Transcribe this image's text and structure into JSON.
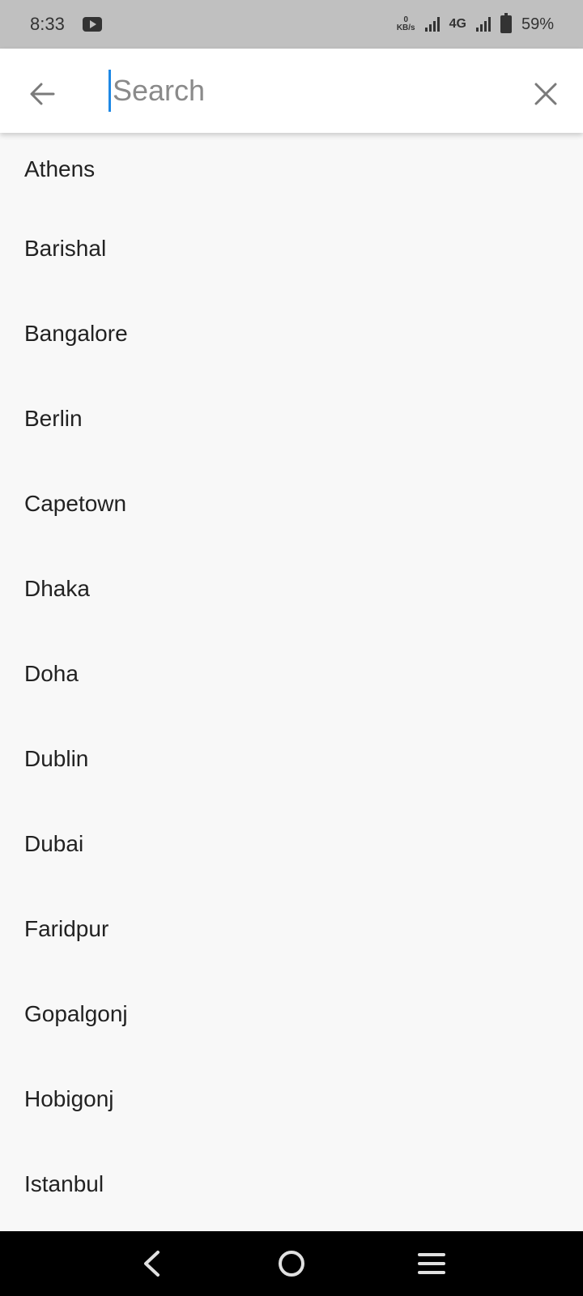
{
  "status_bar": {
    "time": "8:33",
    "net_speed_value": "0",
    "net_speed_unit": "KB/s",
    "network_type": "4G",
    "battery": "59%"
  },
  "search": {
    "placeholder": "Search",
    "value": ""
  },
  "cities": [
    {
      "name": "Athens"
    },
    {
      "name": "Barishal"
    },
    {
      "name": "Bangalore"
    },
    {
      "name": "Berlin"
    },
    {
      "name": "Capetown"
    },
    {
      "name": "Dhaka"
    },
    {
      "name": "Doha"
    },
    {
      "name": "Dublin"
    },
    {
      "name": "Dubai"
    },
    {
      "name": "Faridpur"
    },
    {
      "name": "Gopalgonj"
    },
    {
      "name": "Hobigonj"
    },
    {
      "name": "Istanbul"
    }
  ],
  "colors": {
    "status_bar_bg": "#c0c0c0",
    "app_bar_bg": "#ffffff",
    "list_bg": "#f8f8f8",
    "cursor": "#1e88e5",
    "nav_bar_bg": "#000000"
  },
  "icons": {
    "back": "arrow-left-icon",
    "clear": "close-icon",
    "youtube": "youtube-icon",
    "nav_back": "nav-back-icon",
    "nav_home": "nav-home-icon",
    "nav_menu": "nav-menu-icon"
  }
}
